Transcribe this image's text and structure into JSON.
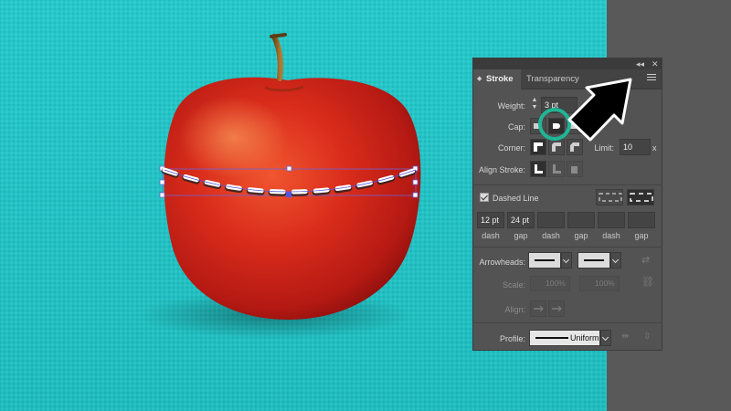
{
  "panel": {
    "collapse_glyph": "◂◂",
    "close_glyph": "✕",
    "tabs": [
      {
        "label": "Stroke",
        "active": true
      },
      {
        "label": "Transparency",
        "active": false
      }
    ],
    "weight": {
      "label": "Weight:",
      "value": "3 pt"
    },
    "cap": {
      "label": "Cap:",
      "selected": "round-cap"
    },
    "corner": {
      "label": "Corner:",
      "limit_label": "Limit:",
      "limit_value": "10",
      "limit_unit": "x"
    },
    "align_stroke": {
      "label": "Align Stroke:"
    },
    "dashed_line": {
      "label": "Dashed Line",
      "checked": true
    },
    "dash_cells": [
      {
        "value": "12 pt",
        "label": "dash"
      },
      {
        "value": "24 pt",
        "label": "gap"
      },
      {
        "value": "",
        "label": "dash"
      },
      {
        "value": "",
        "label": "gap"
      },
      {
        "value": "",
        "label": "dash"
      },
      {
        "value": "",
        "label": "gap"
      }
    ],
    "arrowheads": {
      "label": "Arrowheads:"
    },
    "scale": {
      "label": "Scale:",
      "start": "100%",
      "end": "100%"
    },
    "align": {
      "label": "Align:"
    },
    "profile": {
      "label": "Profile:",
      "value": "Uniform"
    }
  },
  "colors": {
    "background_teal": "#22c2c4",
    "panel_bg": "#535353",
    "highlight_ring": "#1fb596",
    "apple_red": "#d8281c"
  },
  "icons": [
    "collapse-icon",
    "close-icon",
    "panel-menu-icon",
    "round-cap-icon",
    "pointer-arrow-icon"
  ]
}
